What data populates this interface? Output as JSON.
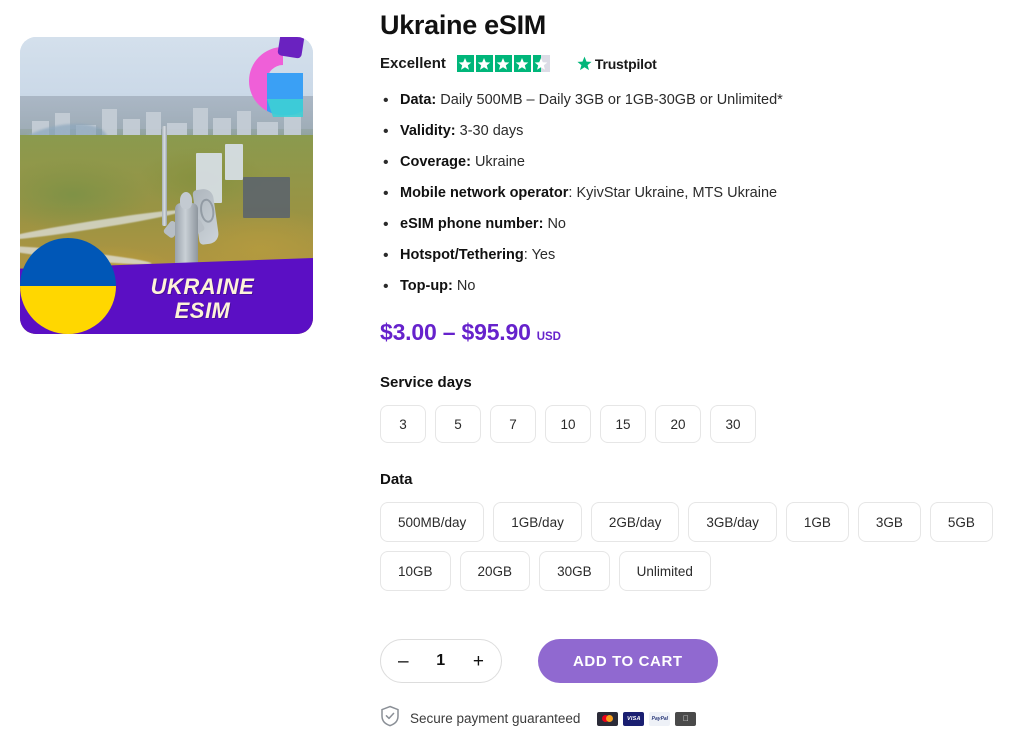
{
  "product": {
    "title": "Ukraine eSIM",
    "image": {
      "banner_line1": "UKRAINE",
      "banner_line2": "ESIM",
      "flag_top_color": "#0057B7",
      "flag_bottom_color": "#FFD700",
      "banner_color": "#5b0fc4",
      "alt": "Aerial view of Kyiv with Motherland Monument"
    }
  },
  "rating": {
    "word": "Excellent",
    "stars_filled": 4,
    "stars_half": 1,
    "stars_total": 5,
    "brand": "Trustpilot",
    "brand_color": "#00B67A"
  },
  "features": [
    {
      "label": "Data:",
      "value": "Daily 500MB – Daily 3GB or 1GB-30GB or Unlimited*"
    },
    {
      "label": "Validity:",
      "value": "3-30 days"
    },
    {
      "label": "Coverage:",
      "value": "Ukraine"
    },
    {
      "label": "Mobile network operator",
      "value": ": KyivStar Ukraine, MTS Ukraine"
    },
    {
      "label": "eSIM phone number:",
      "value": "No"
    },
    {
      "label": "Hotspot/Tethering",
      "value": ": Yes"
    },
    {
      "label": "Top-up:",
      "value": "No"
    }
  ],
  "price": {
    "range": "$3.00 – $95.90",
    "currency": "USD",
    "color": "#6622CC"
  },
  "service_days": {
    "title": "Service days",
    "options": [
      "3",
      "5",
      "7",
      "10",
      "15",
      "20",
      "30"
    ]
  },
  "data": {
    "title": "Data",
    "options": [
      "500MB/day",
      "1GB/day",
      "2GB/day",
      "3GB/day",
      "1GB",
      "3GB",
      "5GB",
      "10GB",
      "20GB",
      "30GB",
      "Unlimited"
    ]
  },
  "cart": {
    "decrement": "–",
    "quantity": "1",
    "increment": "+",
    "add_to_cart_label": "ADD TO CART",
    "button_color": "#9069D0"
  },
  "secure": {
    "text": "Secure payment guaranteed",
    "methods": [
      "mastercard",
      "visa",
      "paypal",
      "applepay"
    ],
    "visa_label": "VISA",
    "paypal_label": "PayPal",
    "applepay_label": "​"
  }
}
